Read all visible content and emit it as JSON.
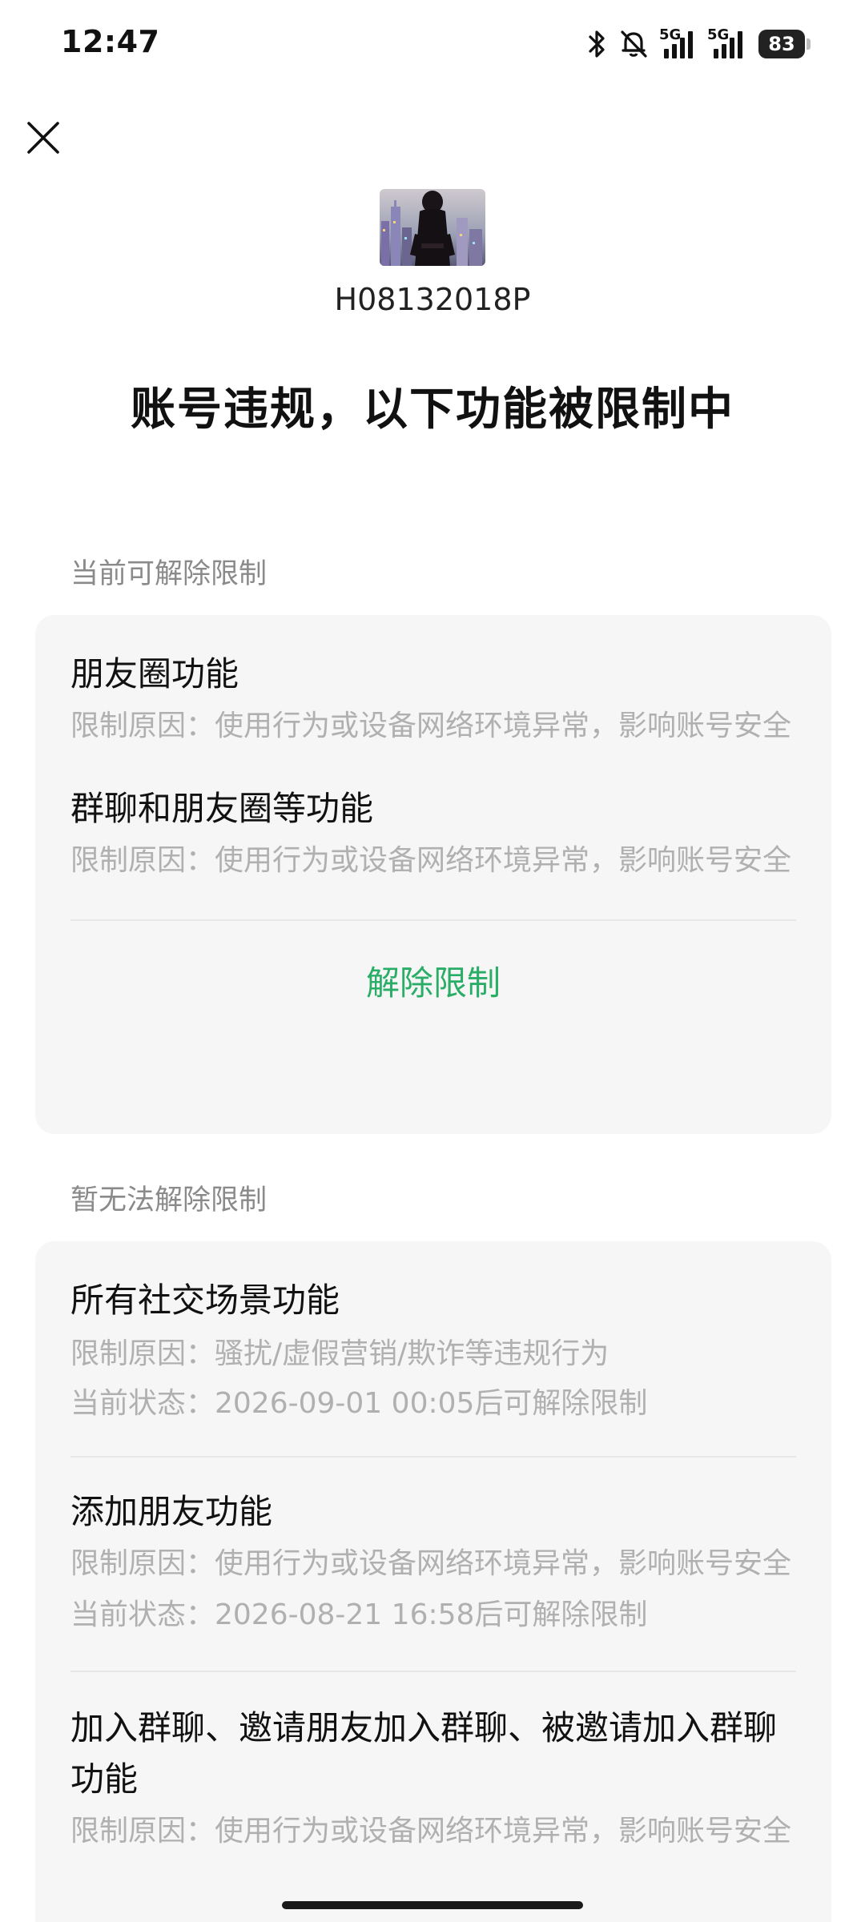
{
  "status_bar": {
    "time": "12:47",
    "network_1": "5G",
    "network_2": "5G",
    "battery": "83"
  },
  "header": {
    "username": "H08132018P",
    "title": "账号违规，以下功能被限制中"
  },
  "removable_section": {
    "label": "当前可解除限制",
    "items": [
      {
        "title": "朋友圈功能",
        "reason": "限制原因：使用行为或设备网络环境异常，影响账号安全"
      },
      {
        "title": "群聊和朋友圈等功能",
        "reason": "限制原因：使用行为或设备网络环境异常，影响账号安全"
      }
    ],
    "button_label": "解除限制"
  },
  "unremovable_section": {
    "label": "暂无法解除限制",
    "items": [
      {
        "title": "所有社交场景功能",
        "reason": "限制原因：骚扰/虚假营销/欺诈等违规行为",
        "status": "当前状态：2026-09-01 00:05后可解除限制"
      },
      {
        "title": "添加朋友功能",
        "reason": "限制原因：使用行为或设备网络环境异常，影响账号安全",
        "status": "当前状态：2026-08-21 16:58后可解除限制"
      },
      {
        "title": "加入群聊、邀请朋友加入群聊、被邀请加入群聊功能",
        "reason": "限制原因：使用行为或设备网络环境异常，影响账号安全"
      }
    ]
  },
  "colors": {
    "accent_green": "#2aae67",
    "card_bg": "#f6f6f6",
    "muted_text": "#b0b0b0",
    "section_label": "#8a8a8a"
  },
  "icons": [
    "close-icon",
    "bluetooth-icon",
    "mute-bell-icon",
    "signal-icon",
    "battery-icon"
  ]
}
